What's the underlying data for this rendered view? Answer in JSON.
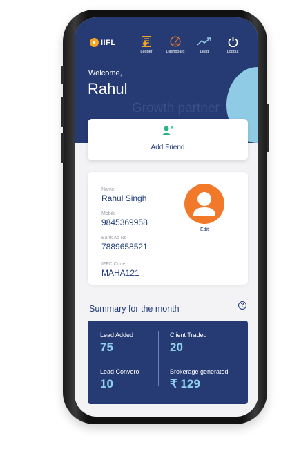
{
  "brand": {
    "logo_text": "IIFL"
  },
  "nav": [
    {
      "label": "Ledger",
      "icon": "ledger-icon"
    },
    {
      "label": "Dashboard",
      "icon": "dashboard-gauge-icon"
    },
    {
      "label": "Lead",
      "icon": "trend-up-icon"
    },
    {
      "label": "Logout",
      "icon": "power-icon"
    }
  ],
  "header": {
    "welcome": "Welcome,",
    "user_name": "Rahul",
    "tagline": "Growth partner"
  },
  "add_friend": {
    "label": "Add Friend",
    "icon": "add-person-icon"
  },
  "profile": {
    "name_label": "Name",
    "name_value": "Rahul Singh",
    "mobile_label": "Mobile",
    "mobile_value": "9845369958",
    "bank_label": "Bank Ac No",
    "bank_value": "7889658521",
    "ifsc_label": "IFFC Code",
    "ifsc_value": "MAHA121",
    "edit_label": "Edit"
  },
  "summary": {
    "title": "Summary for the month",
    "help_glyph": "?",
    "lead_added_label": "Lead Added",
    "lead_added_value": "75",
    "client_traded_label": "Client Traded",
    "client_traded_value": "20",
    "lead_converted_label": "Lead Convero",
    "lead_converted_value": "10",
    "brokerage_label": "Brokerage generated",
    "brokerage_value": "₹ 129"
  },
  "colors": {
    "primary": "#263a74",
    "accent_orange": "#f2782a",
    "accent_blue": "#8fcbe4",
    "icon_green": "#2cb38c"
  }
}
